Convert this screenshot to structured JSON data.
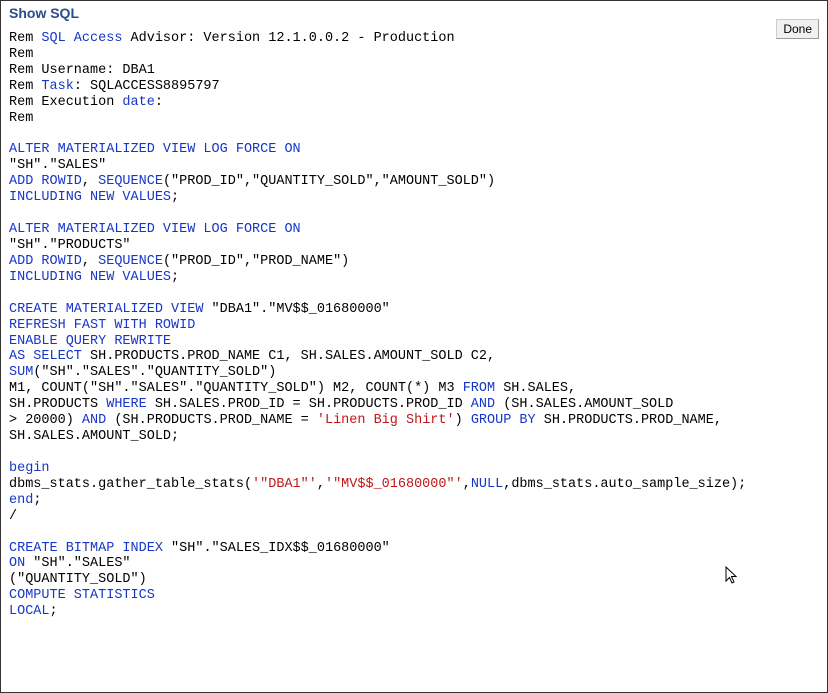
{
  "header": {
    "title": "Show SQL",
    "done_label": "Done"
  },
  "sql": {
    "l01a": "Rem ",
    "l01b": "SQL Access",
    "l01c": " Advisor: Version 12.1.0.0.2 - Production",
    "l02": "Rem",
    "l03": "Rem Username: DBA1",
    "l04a": "Rem ",
    "l04b": "Task",
    "l04c": ": SQLACCESS8895797",
    "l05a": "Rem Execution ",
    "l05b": "date",
    "l05c": ":",
    "l06": "Rem",
    "l07": "ALTER MATERIALIZED VIEW LOG FORCE ON",
    "l08": "\"SH\".\"SALES\"",
    "l09a": "ADD ROWID",
    "l09b": ", ",
    "l09c": "SEQUENCE",
    "l09d": "(\"PROD_ID\",\"QUANTITY_SOLD\",\"AMOUNT_SOLD\")",
    "l10a": "INCLUDING NEW VALUES",
    "l10b": ";",
    "l11": "ALTER MATERIALIZED VIEW LOG FORCE ON",
    "l12": "\"SH\".\"PRODUCTS\"",
    "l13a": "ADD ROWID",
    "l13b": ", ",
    "l13c": "SEQUENCE",
    "l13d": "(\"PROD_ID\",\"PROD_NAME\")",
    "l14a": "INCLUDING NEW VALUES",
    "l14b": ";",
    "l15a": "CREATE MATERIALIZED VIEW",
    "l15b": " \"DBA1\".\"MV$$_01680000\"",
    "l16": "REFRESH FAST WITH ROWID",
    "l17": "ENABLE QUERY REWRITE",
    "l18a": "AS SELECT",
    "l18b": " SH.PRODUCTS.PROD_NAME C1, SH.SALES.AMOUNT_SOLD C2,",
    "l19a": "SUM",
    "l19b": "(\"SH\".\"SALES\".\"QUANTITY_SOLD\")",
    "l20a": "M1, COUNT(\"SH\".\"SALES\".\"QUANTITY_SOLD\") M2, COUNT(*) M3 ",
    "l20b": "FROM",
    "l20c": " SH.SALES,",
    "l21a": "SH.PRODUCTS ",
    "l21b": "WHERE",
    "l21c": " SH.SALES.PROD_ID = SH.PRODUCTS.PROD_ID ",
    "l21d": "AND",
    "l21e": " (SH.SALES.AMOUNT_SOLD",
    "l22a": "> 20000) ",
    "l22b": "AND",
    "l22c": " (SH.PRODUCTS.PROD_NAME = ",
    "l22d": "'Linen Big Shirt'",
    "l22e": ") ",
    "l22f": "GROUP BY",
    "l22g": " SH.PRODUCTS.PROD_NAME,",
    "l23": "SH.SALES.AMOUNT_SOLD;",
    "l24": "begin",
    "l25a": "dbms_stats.gather_table_stats(",
    "l25b": "'\"DBA1\"'",
    "l25c": ",",
    "l25d": "'\"MV$$_01680000\"'",
    "l25e": ",",
    "l25f": "NULL",
    "l25g": ",dbms_stats.auto_sample_size);",
    "l26": "end",
    "l26b": ";",
    "l27": "/",
    "l28a": "CREATE BITMAP INDEX",
    "l28b": " \"SH\".\"SALES_IDX$$_01680000\"",
    "l29a": "ON",
    "l29b": " \"SH\".\"SALES\"",
    "l30": "(\"QUANTITY_SOLD\")",
    "l31": "COMPUTE STATISTICS",
    "l32a": "LOCAL",
    "l32b": ";"
  }
}
